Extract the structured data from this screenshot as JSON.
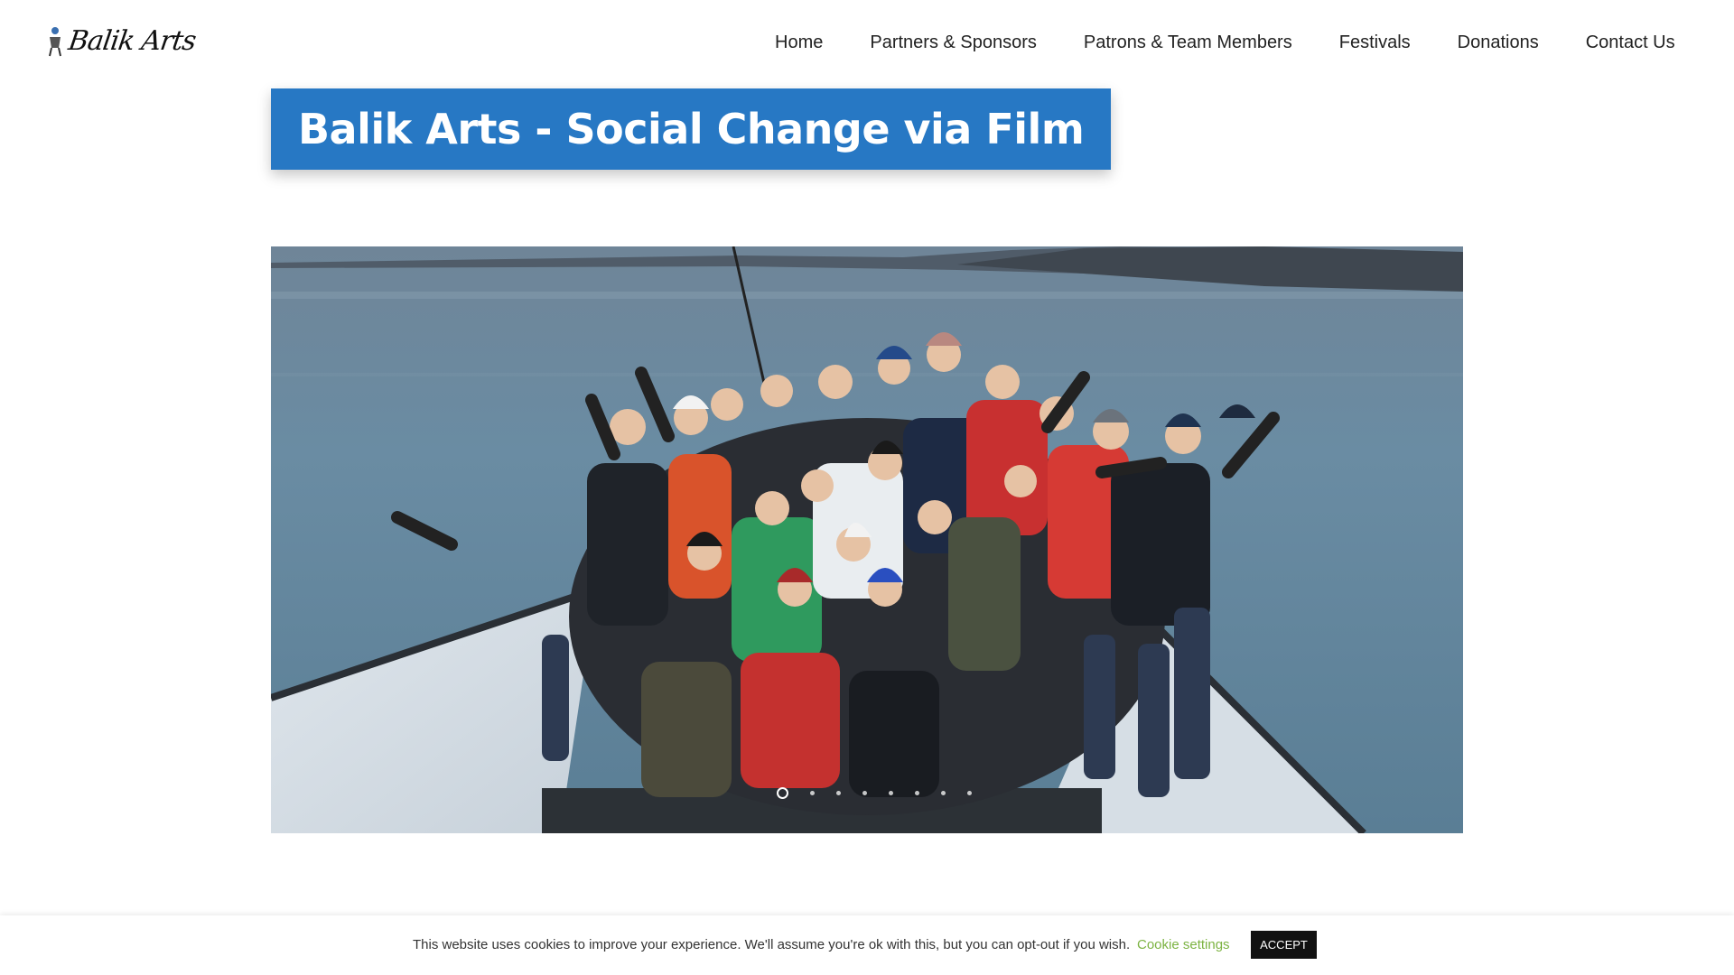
{
  "site": {
    "logo_text": "Balik Arts"
  },
  "nav": {
    "items": [
      {
        "label": "Home"
      },
      {
        "label": "Partners & Sponsors"
      },
      {
        "label": "Patrons & Team Members"
      },
      {
        "label": "Festivals"
      },
      {
        "label": "Donations"
      },
      {
        "label": "Contact Us"
      }
    ]
  },
  "hero": {
    "title": "Balik Arts - Social Change via Film",
    "slider": {
      "total_slides": 8,
      "active_slide": 1
    }
  },
  "cookie_bar": {
    "message": "This website uses cookies to improve your experience. We'll assume you're ok with this, but you can opt-out if you wish.",
    "settings_label": "Cookie settings",
    "accept_label": "ACCEPT"
  },
  "colors": {
    "title_banner": "#2778c4",
    "cookie_link": "#7cb342",
    "accept_button": "#111111"
  }
}
